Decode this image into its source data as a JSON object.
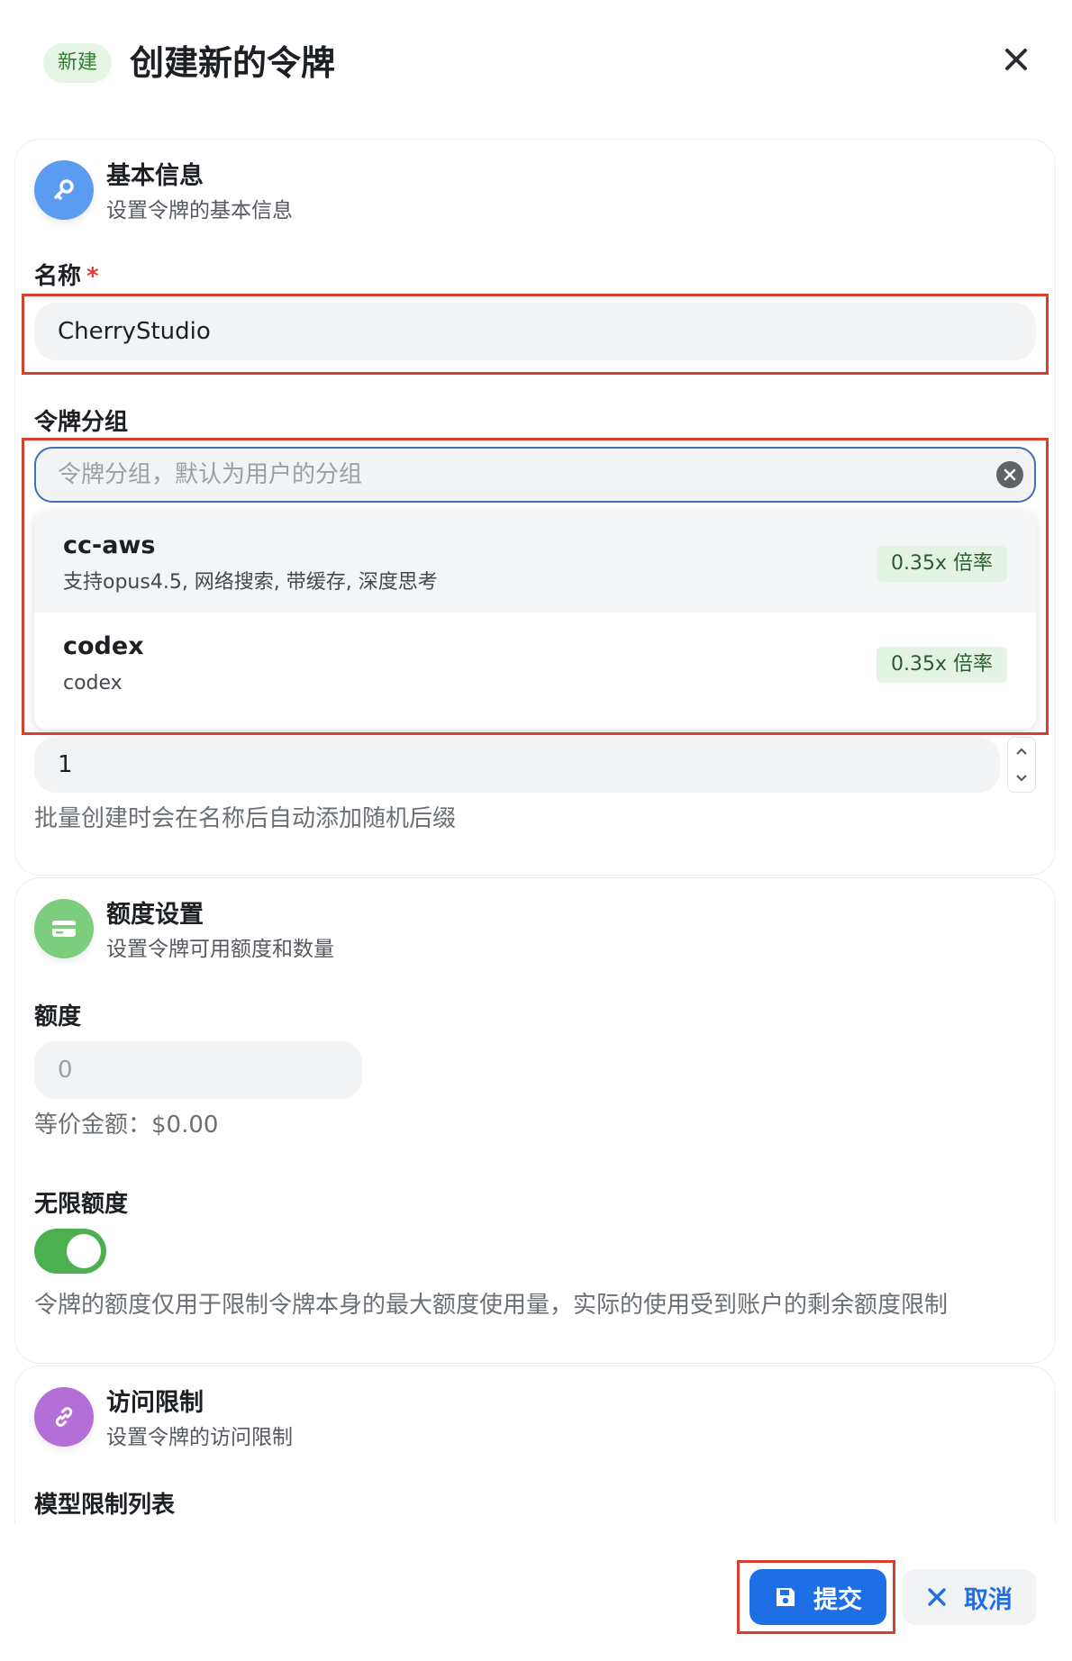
{
  "header": {
    "badge": "新建",
    "title": "创建新的令牌"
  },
  "basic": {
    "title": "基本信息",
    "subtitle": "设置令牌的基本信息",
    "name_label": "名称",
    "name_required": "*",
    "name_value": "CherryStudio",
    "group_label": "令牌分组",
    "group_placeholder": "令牌分组，默认为用户的分组",
    "group_options": [
      {
        "name": "cc-aws",
        "desc": "支持opus4.5, 网络搜索, 带缓存, 深度思考",
        "rate": "0.35x 倍率"
      },
      {
        "name": "codex",
        "desc": "codex",
        "rate": "0.35x 倍率"
      }
    ],
    "count_value": "1",
    "count_hint": "批量创建时会在名称后自动添加随机后缀"
  },
  "quota": {
    "title": "额度设置",
    "subtitle": "设置令牌可用额度和数量",
    "quota_label": "额度",
    "quota_placeholder": "0",
    "equiv": "等价金额：$0.00",
    "unlimited_label": "无限额度",
    "unlimited_on": true,
    "note": "令牌的额度仅用于限制令牌本身的最大额度使用量，实际的使用受到账户的剩余额度限制"
  },
  "access": {
    "title": "访问限制",
    "subtitle": "设置令牌的访问限制",
    "model_list_label": "模型限制列表"
  },
  "footer": {
    "submit": "提交",
    "cancel": "取消"
  },
  "colors": {
    "primary": "#1e6fe6",
    "highlight": "#d6412f",
    "toggle_on": "#4caf50",
    "icon_key": "#5b9cf0",
    "icon_card": "#7ccd7e",
    "icon_link": "#b46fd6"
  },
  "icons": {
    "close": "close-icon",
    "key": "key-icon",
    "card": "credit-card-icon",
    "link": "link-icon",
    "save": "save-icon",
    "cancel": "x-icon"
  }
}
